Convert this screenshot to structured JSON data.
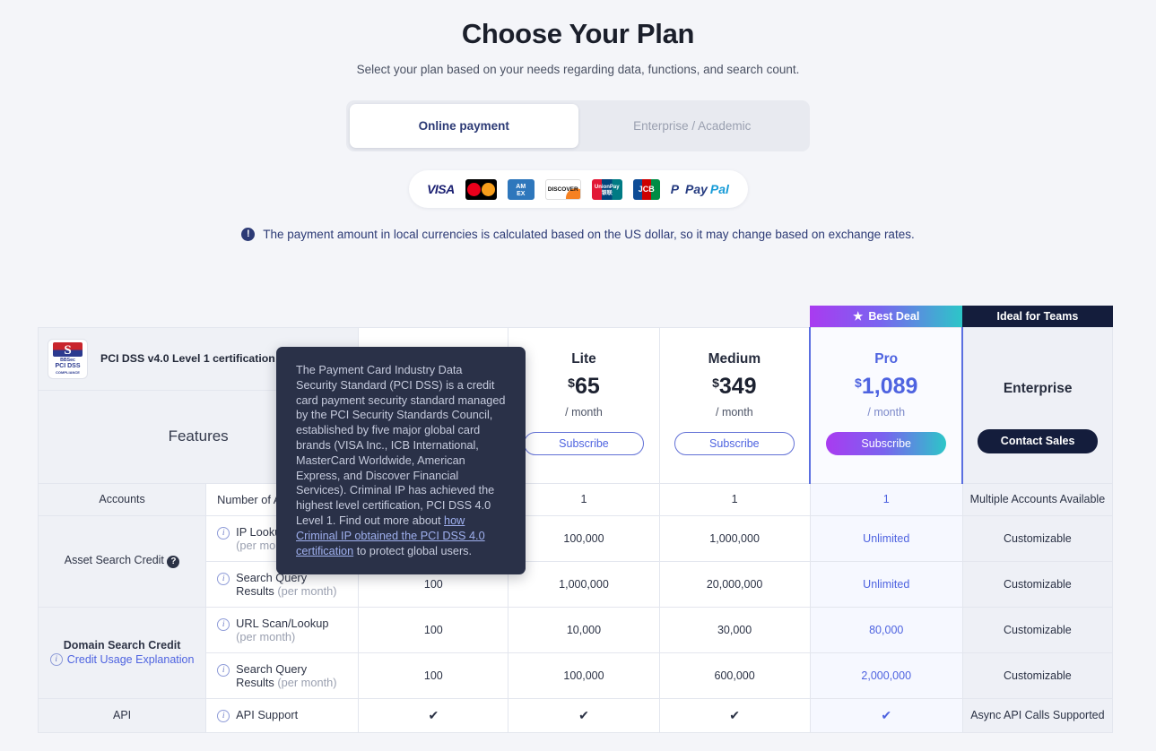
{
  "hero": {
    "title": "Choose Your Plan",
    "subtitle": "Select your plan based on your needs regarding data, functions, and search count."
  },
  "toggle": {
    "online_label": "Online payment",
    "enterprise_label": "Enterprise / Academic"
  },
  "payment_methods": [
    {
      "name": "visa",
      "label": "VISA"
    },
    {
      "name": "mastercard",
      "label": ""
    },
    {
      "name": "amex",
      "label": "AM EX"
    },
    {
      "name": "discover",
      "label": "DISCOVER"
    },
    {
      "name": "unionpay",
      "label": "UnionPay"
    },
    {
      "name": "jcb",
      "label": "JCB"
    },
    {
      "name": "paypal",
      "label": "Pay",
      "label2": "Pal"
    }
  ],
  "notice": {
    "icon": "info-icon",
    "text": "The payment amount in local currencies is calculated based on the US dollar, so it may change based on exchange rates."
  },
  "pci": {
    "badge_top": "S",
    "badge_line1": "BBSec",
    "badge_line2": "PCI DSS",
    "badge_line3": "COMPLIANCE",
    "label": "PCI DSS v4.0 Level 1 certification",
    "help": "?"
  },
  "tooltip": {
    "part1": "The Payment Card Industry Data Security Standard (PCI DSS) is a credit card payment security standard managed by the PCI Security Standards Council, established by five major global card brands (VISA Inc., ICB International, MasterCard Worldwide, American Express, and Discover Financial Services). Criminal IP has achieved the highest level certification, PCI DSS 4.0 Level 1. Find out more about ",
    "link": "how Criminal IP obtained the PCI DSS 4.0 certification",
    "part2": " to protect global users."
  },
  "features_label": "Features",
  "badges": {
    "best_deal": "Best Deal",
    "best_deal_star": "★",
    "ideal_for_teams": "Ideal for Teams"
  },
  "plans": [
    {
      "name": "",
      "currency": "",
      "price": "",
      "per": "",
      "cta": ""
    },
    {
      "name": "Lite",
      "currency": "$",
      "price": "65",
      "per": "/ month",
      "cta": "Subscribe"
    },
    {
      "name": "Medium",
      "currency": "$",
      "price": "349",
      "per": "/ month",
      "cta": "Subscribe"
    },
    {
      "name": "Pro",
      "currency": "$",
      "price": "1,089",
      "per": "/ month",
      "cta": "Subscribe"
    },
    {
      "name": "Enterprise",
      "currency": "",
      "price": "",
      "per": "",
      "cta": "Contact Sales"
    }
  ],
  "rows": [
    {
      "group": "Accounts",
      "group_link": "",
      "group_help": "",
      "feature": "Number of Accounts",
      "feature_note": "",
      "has_info": false,
      "values": [
        "",
        "1",
        "1",
        "1",
        "Multiple Accounts Available"
      ]
    },
    {
      "group": "Asset Search Credit",
      "group_link": "",
      "group_help": "?",
      "feature": "IP Lookup",
      "feature_note": "(per month)",
      "has_info": true,
      "values": [
        "",
        "100,000",
        "1,000,000",
        "Unlimited",
        "Customizable"
      ]
    },
    {
      "group": "",
      "group_link": "",
      "group_help": "",
      "feature": "Search Query Results",
      "feature_note": "(per month)",
      "has_info": true,
      "values": [
        "100",
        "1,000,000",
        "20,000,000",
        "Unlimited",
        "Customizable"
      ]
    },
    {
      "group": "Domain Search Credit",
      "group_link": "Credit Usage Explanation",
      "group_help": "",
      "feature": "URL Scan/Lookup",
      "feature_note": "(per month)",
      "has_info": true,
      "values": [
        "100",
        "10,000",
        "30,000",
        "80,000",
        "Customizable"
      ]
    },
    {
      "group": "",
      "group_link": "",
      "group_help": "",
      "feature": "Search Query Results",
      "feature_note": "(per month)",
      "has_info": true,
      "values": [
        "100",
        "100,000",
        "600,000",
        "2,000,000",
        "Customizable"
      ]
    },
    {
      "group": "API",
      "group_link": "",
      "group_help": "",
      "feature": "API Support",
      "feature_note": "",
      "has_info": true,
      "values": [
        "✔",
        "✔",
        "✔",
        "✔",
        "Async API Calls Supported"
      ]
    }
  ],
  "colors": {
    "accent": "#4e63e0",
    "dark": "#141d3c",
    "gradient_start": "#a93bf0",
    "gradient_end": "#2cc6c8",
    "page_bg": "#f4f5f9"
  }
}
